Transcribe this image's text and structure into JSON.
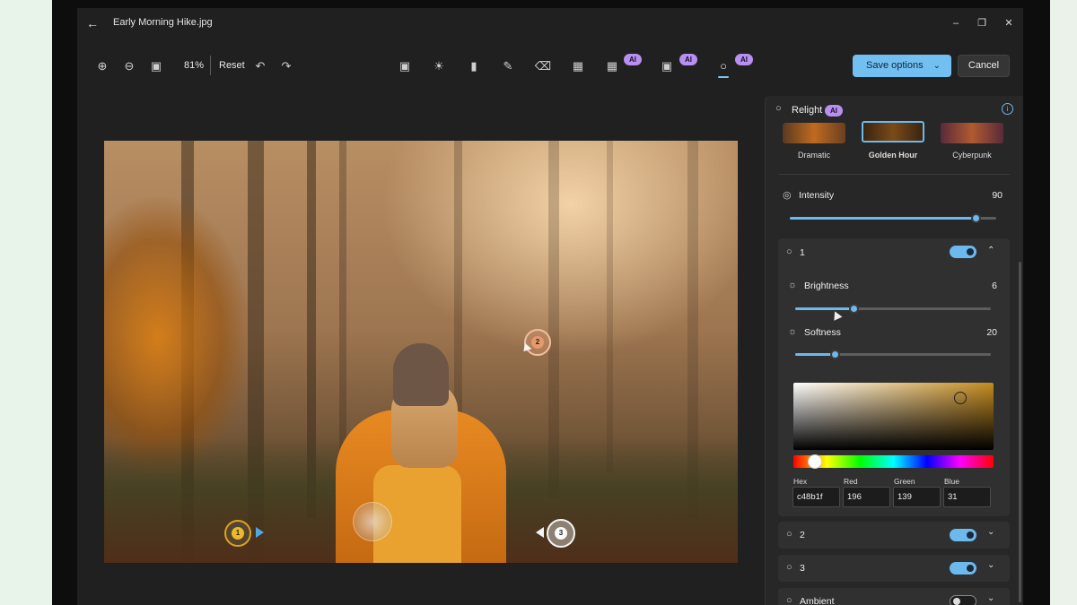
{
  "window": {
    "title": "Early Morning Hike.jpg"
  },
  "toolbar": {
    "zoom": "81%",
    "reset_label": "Reset",
    "ai_badge": "AI",
    "save_label": "Save options",
    "cancel_label": "Cancel"
  },
  "panel": {
    "title": "Relight",
    "title_badge": "AI",
    "presets": [
      {
        "label": "Dramatic",
        "selected": false
      },
      {
        "label": "Golden Hour",
        "selected": true
      },
      {
        "label": "Cyberpunk",
        "selected": false
      }
    ],
    "intensity": {
      "label": "Intensity",
      "value": "90",
      "fraction": 0.9
    },
    "light1": {
      "label": "1",
      "enabled": true,
      "expanded": true,
      "brightness": {
        "label": "Brightness",
        "value": "6",
        "fraction": 0.3
      },
      "softness": {
        "label": "Softness",
        "value": "20",
        "fraction": 0.2
      },
      "color": {
        "hex_label": "Hex",
        "hex": "c48b1f",
        "red_label": "Red",
        "red": "196",
        "green_label": "Green",
        "green": "139",
        "blue_label": "Blue",
        "blue": "31"
      }
    },
    "light2": {
      "label": "2",
      "enabled": true
    },
    "light3": {
      "label": "3",
      "enabled": true
    },
    "ambient": {
      "label": "Ambient",
      "enabled": false
    }
  },
  "canvas": {
    "pins": [
      "1",
      "2",
      "3"
    ]
  },
  "colors": {
    "accent": "#6cb9ee",
    "ai_badge": "#b98ff0",
    "light_color": "#c48b1f"
  }
}
